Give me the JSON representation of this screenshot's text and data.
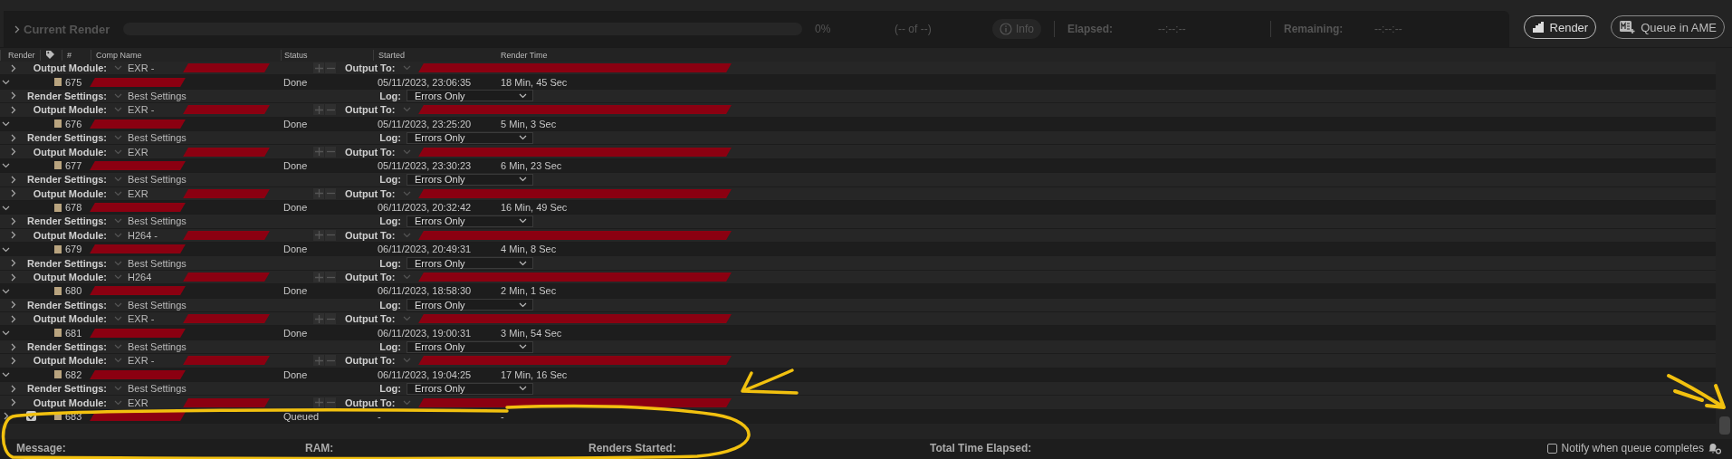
{
  "panel": {
    "title": "Current Render",
    "progress_text": "0%",
    "count_text": "(-- of --)",
    "info_button": "Info",
    "elapsed_label": "Elapsed:",
    "elapsed_value": "--:--:--",
    "remaining_label": "Remaining:",
    "remaining_value": "--:--:--",
    "level": 0
  },
  "buttons": [
    {
      "kind": "render",
      "label": "Render"
    },
    {
      "kind": "ame",
      "label": "Queue in AME"
    }
  ],
  "columns": [
    "Render",
    "#",
    "Comp Name",
    "Status",
    "Started",
    "Render Time"
  ],
  "rows": [
    {
      "kind": "output",
      "label": "Output Module:",
      "value": "EXR -",
      "output_label": "Output To:"
    },
    {
      "kind": "item",
      "number": "675",
      "status": "Done",
      "started": "05/11/2023, 23:06:35",
      "render_time": "18 Min, 45 Sec",
      "expanded": true
    },
    {
      "kind": "settings",
      "label": "Render Settings:",
      "value": "Best Settings",
      "log_label": "Log:",
      "log_value": "Errors Only"
    },
    {
      "kind": "output",
      "label": "Output Module:",
      "value": "EXR -",
      "output_label": "Output To:"
    },
    {
      "kind": "item",
      "number": "676",
      "status": "Done",
      "started": "05/11/2023, 23:25:20",
      "render_time": "5 Min, 3 Sec",
      "expanded": true
    },
    {
      "kind": "settings",
      "label": "Render Settings:",
      "value": "Best Settings",
      "log_label": "Log:",
      "log_value": "Errors Only"
    },
    {
      "kind": "output",
      "label": "Output Module:",
      "value": "EXR",
      "output_label": "Output To:"
    },
    {
      "kind": "item",
      "number": "677",
      "status": "Done",
      "started": "05/11/2023, 23:30:23",
      "render_time": "6 Min, 23 Sec",
      "expanded": true
    },
    {
      "kind": "settings",
      "label": "Render Settings:",
      "value": "Best Settings",
      "log_label": "Log:",
      "log_value": "Errors Only"
    },
    {
      "kind": "output",
      "label": "Output Module:",
      "value": "EXR",
      "output_label": "Output To:"
    },
    {
      "kind": "item",
      "number": "678",
      "status": "Done",
      "started": "06/11/2023, 20:32:42",
      "render_time": "16 Min, 49 Sec",
      "expanded": true
    },
    {
      "kind": "settings",
      "label": "Render Settings:",
      "value": "Best Settings",
      "log_label": "Log:",
      "log_value": "Errors Only"
    },
    {
      "kind": "output",
      "label": "Output Module:",
      "value": "H264 -",
      "output_label": "Output To:"
    },
    {
      "kind": "item",
      "number": "679",
      "status": "Done",
      "started": "06/11/2023, 20:49:31",
      "render_time": "4 Min, 8 Sec",
      "expanded": true
    },
    {
      "kind": "settings",
      "label": "Render Settings:",
      "value": "Best Settings",
      "log_label": "Log:",
      "log_value": "Errors Only"
    },
    {
      "kind": "output",
      "label": "Output Module:",
      "value": "H264",
      "output_label": "Output To:"
    },
    {
      "kind": "item",
      "number": "680",
      "status": "Done",
      "started": "06/11/2023, 18:58:30",
      "render_time": "2 Min, 1 Sec",
      "expanded": true
    },
    {
      "kind": "settings",
      "label": "Render Settings:",
      "value": "Best Settings",
      "log_label": "Log:",
      "log_value": "Errors Only"
    },
    {
      "kind": "output",
      "label": "Output Module:",
      "value": "EXR -",
      "output_label": "Output To:"
    },
    {
      "kind": "item",
      "number": "681",
      "status": "Done",
      "started": "06/11/2023, 19:00:31",
      "render_time": "3 Min, 54 Sec",
      "expanded": true
    },
    {
      "kind": "settings",
      "label": "Render Settings:",
      "value": "Best Settings",
      "log_label": "Log:",
      "log_value": "Errors Only"
    },
    {
      "kind": "output",
      "label": "Output Module:",
      "value": "EXR -",
      "output_label": "Output To:"
    },
    {
      "kind": "item",
      "number": "682",
      "status": "Done",
      "started": "06/11/2023, 19:04:25",
      "render_time": "17 Min, 16 Sec",
      "expanded": true
    },
    {
      "kind": "settings",
      "label": "Render Settings:",
      "value": "Best Settings",
      "log_label": "Log:",
      "log_value": "Errors Only"
    },
    {
      "kind": "output",
      "label": "Output Module:",
      "value": "EXR",
      "output_label": "Output To:"
    },
    {
      "kind": "item",
      "number": "683",
      "status": "Queued",
      "started": "-",
      "render_time": "-",
      "expanded": false,
      "checked": true
    }
  ],
  "footer": {
    "message_label": "Message:",
    "ram_label": "RAM:",
    "renders_started_label": "Renders Started:",
    "total_time_label": "Total Time Elapsed:",
    "notify": {
      "label": "Notify when queue completes",
      "checked": false
    }
  }
}
